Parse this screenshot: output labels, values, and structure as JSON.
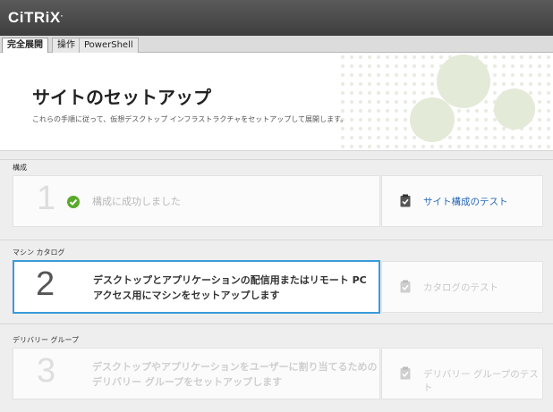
{
  "app": {
    "brand": "CiTRiX",
    "brand_mark": "."
  },
  "tabs": [
    {
      "label": "完全展開",
      "active": true
    },
    {
      "label": "操作",
      "active": false
    },
    {
      "label": "PowerShell",
      "active": false
    }
  ],
  "header": {
    "title": "サイトのセットアップ",
    "subtitle": "これらの手順に従って、仮想デスクトップ インフラストラクチャをセットアップして展開します。"
  },
  "sections": [
    {
      "label": "構成",
      "number": "1",
      "text_lines": [
        "構成に成功しました"
      ],
      "status": "success",
      "test_label": "サイト構成のテスト",
      "test_enabled": true
    },
    {
      "label": "マシン カタログ",
      "number": "2",
      "text_lines": [
        "デスクトップとアプリケーションの配信用またはリモート PC",
        "アクセス用にマシンをセットアップします"
      ],
      "status": "active",
      "test_label": "カタログのテスト",
      "test_enabled": false
    },
    {
      "label": "デリバリー グループ",
      "number": "3",
      "text_lines": [
        "デスクトップやアプリケーションをユーザーに割り当てるための",
        "デリバリー グループをセットアップします"
      ],
      "status": "disabled",
      "test_label": "デリバリー グループのテスト",
      "test_enabled": false
    }
  ],
  "colors": {
    "topbar": "#4a4a4a",
    "active_border": "#3a9ad9",
    "success_green": "#5aa92b",
    "link_blue": "#2a6ab8"
  }
}
